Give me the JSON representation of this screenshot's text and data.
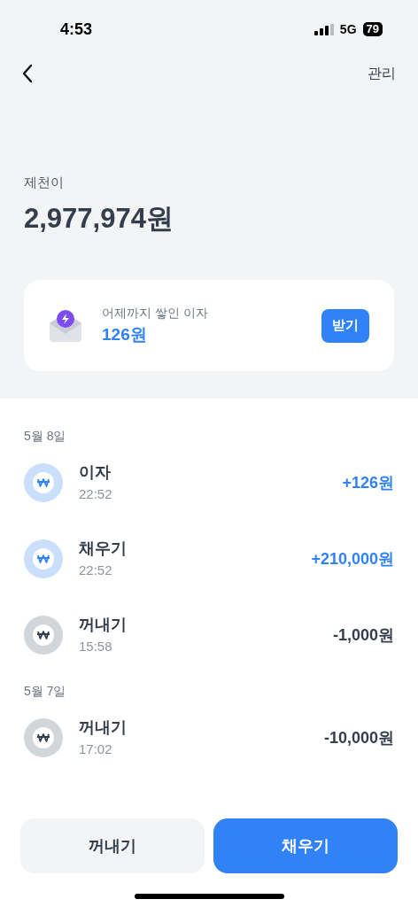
{
  "status_bar": {
    "time": "4:53",
    "network": "5G",
    "battery": "79"
  },
  "header": {
    "action": "관리"
  },
  "account": {
    "name": "제천이",
    "balance": "2,977,974원"
  },
  "interest_card": {
    "label": "어제까지 쌓인 이자",
    "amount": "126원",
    "button": "받기"
  },
  "groups": [
    {
      "date": "5월 8일",
      "items": [
        {
          "title": "이자",
          "time": "22:52",
          "amount": "+126원",
          "kind": "in"
        },
        {
          "title": "채우기",
          "time": "22:52",
          "amount": "+210,000원",
          "kind": "in"
        },
        {
          "title": "꺼내기",
          "time": "15:58",
          "amount": "-1,000원",
          "kind": "out"
        }
      ]
    },
    {
      "date": "5월 7일",
      "items": [
        {
          "title": "꺼내기",
          "time": "17:02",
          "amount": "-10,000원",
          "kind": "out"
        }
      ]
    }
  ],
  "buttons": [
    {
      "label": "꺼내기",
      "kind": "secondary"
    },
    {
      "label": "채우기",
      "kind": "primary"
    }
  ]
}
